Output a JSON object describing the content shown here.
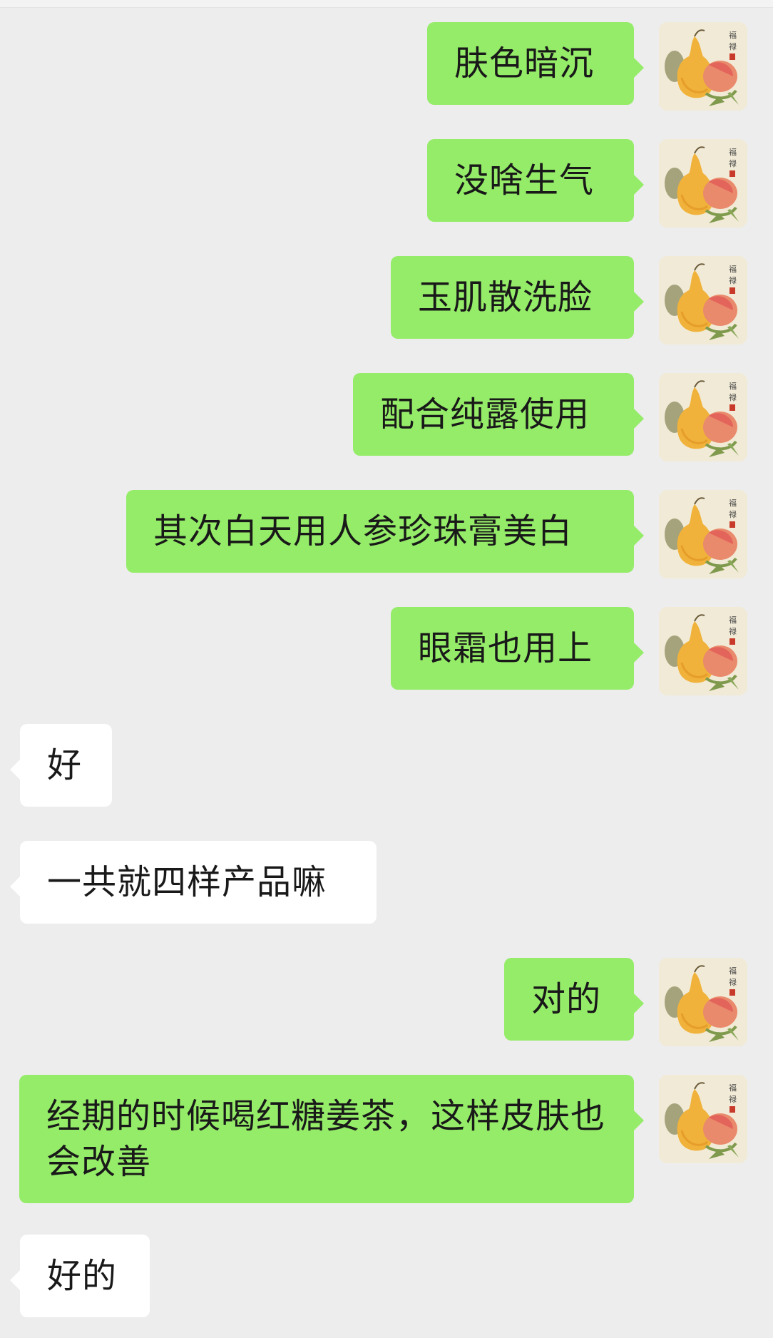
{
  "messages": [
    {
      "side": "out",
      "text": "肤色暗沉"
    },
    {
      "side": "out",
      "text": "没啥生气"
    },
    {
      "side": "out",
      "text": "玉肌散洗脸"
    },
    {
      "side": "out",
      "text": "配合纯露使用"
    },
    {
      "side": "out",
      "text": "其次白天用人参珍珠膏美白"
    },
    {
      "side": "out",
      "text": "眼霜也用上"
    },
    {
      "side": "in",
      "text": "好"
    },
    {
      "side": "in",
      "text": "一共就四样产品嘛"
    },
    {
      "side": "out",
      "text": "对的"
    },
    {
      "side": "out",
      "text": "经期的时候喝红糖姜茶，这样皮肤也会改善"
    },
    {
      "side": "in",
      "text": "好的"
    }
  ],
  "avatar": {
    "icon": "peach-pear-painting-icon",
    "calligraphy": "福禄"
  },
  "colors": {
    "background": "#ededed",
    "outgoing_bubble": "#95ec69",
    "incoming_bubble": "#ffffff",
    "text": "#191919"
  }
}
